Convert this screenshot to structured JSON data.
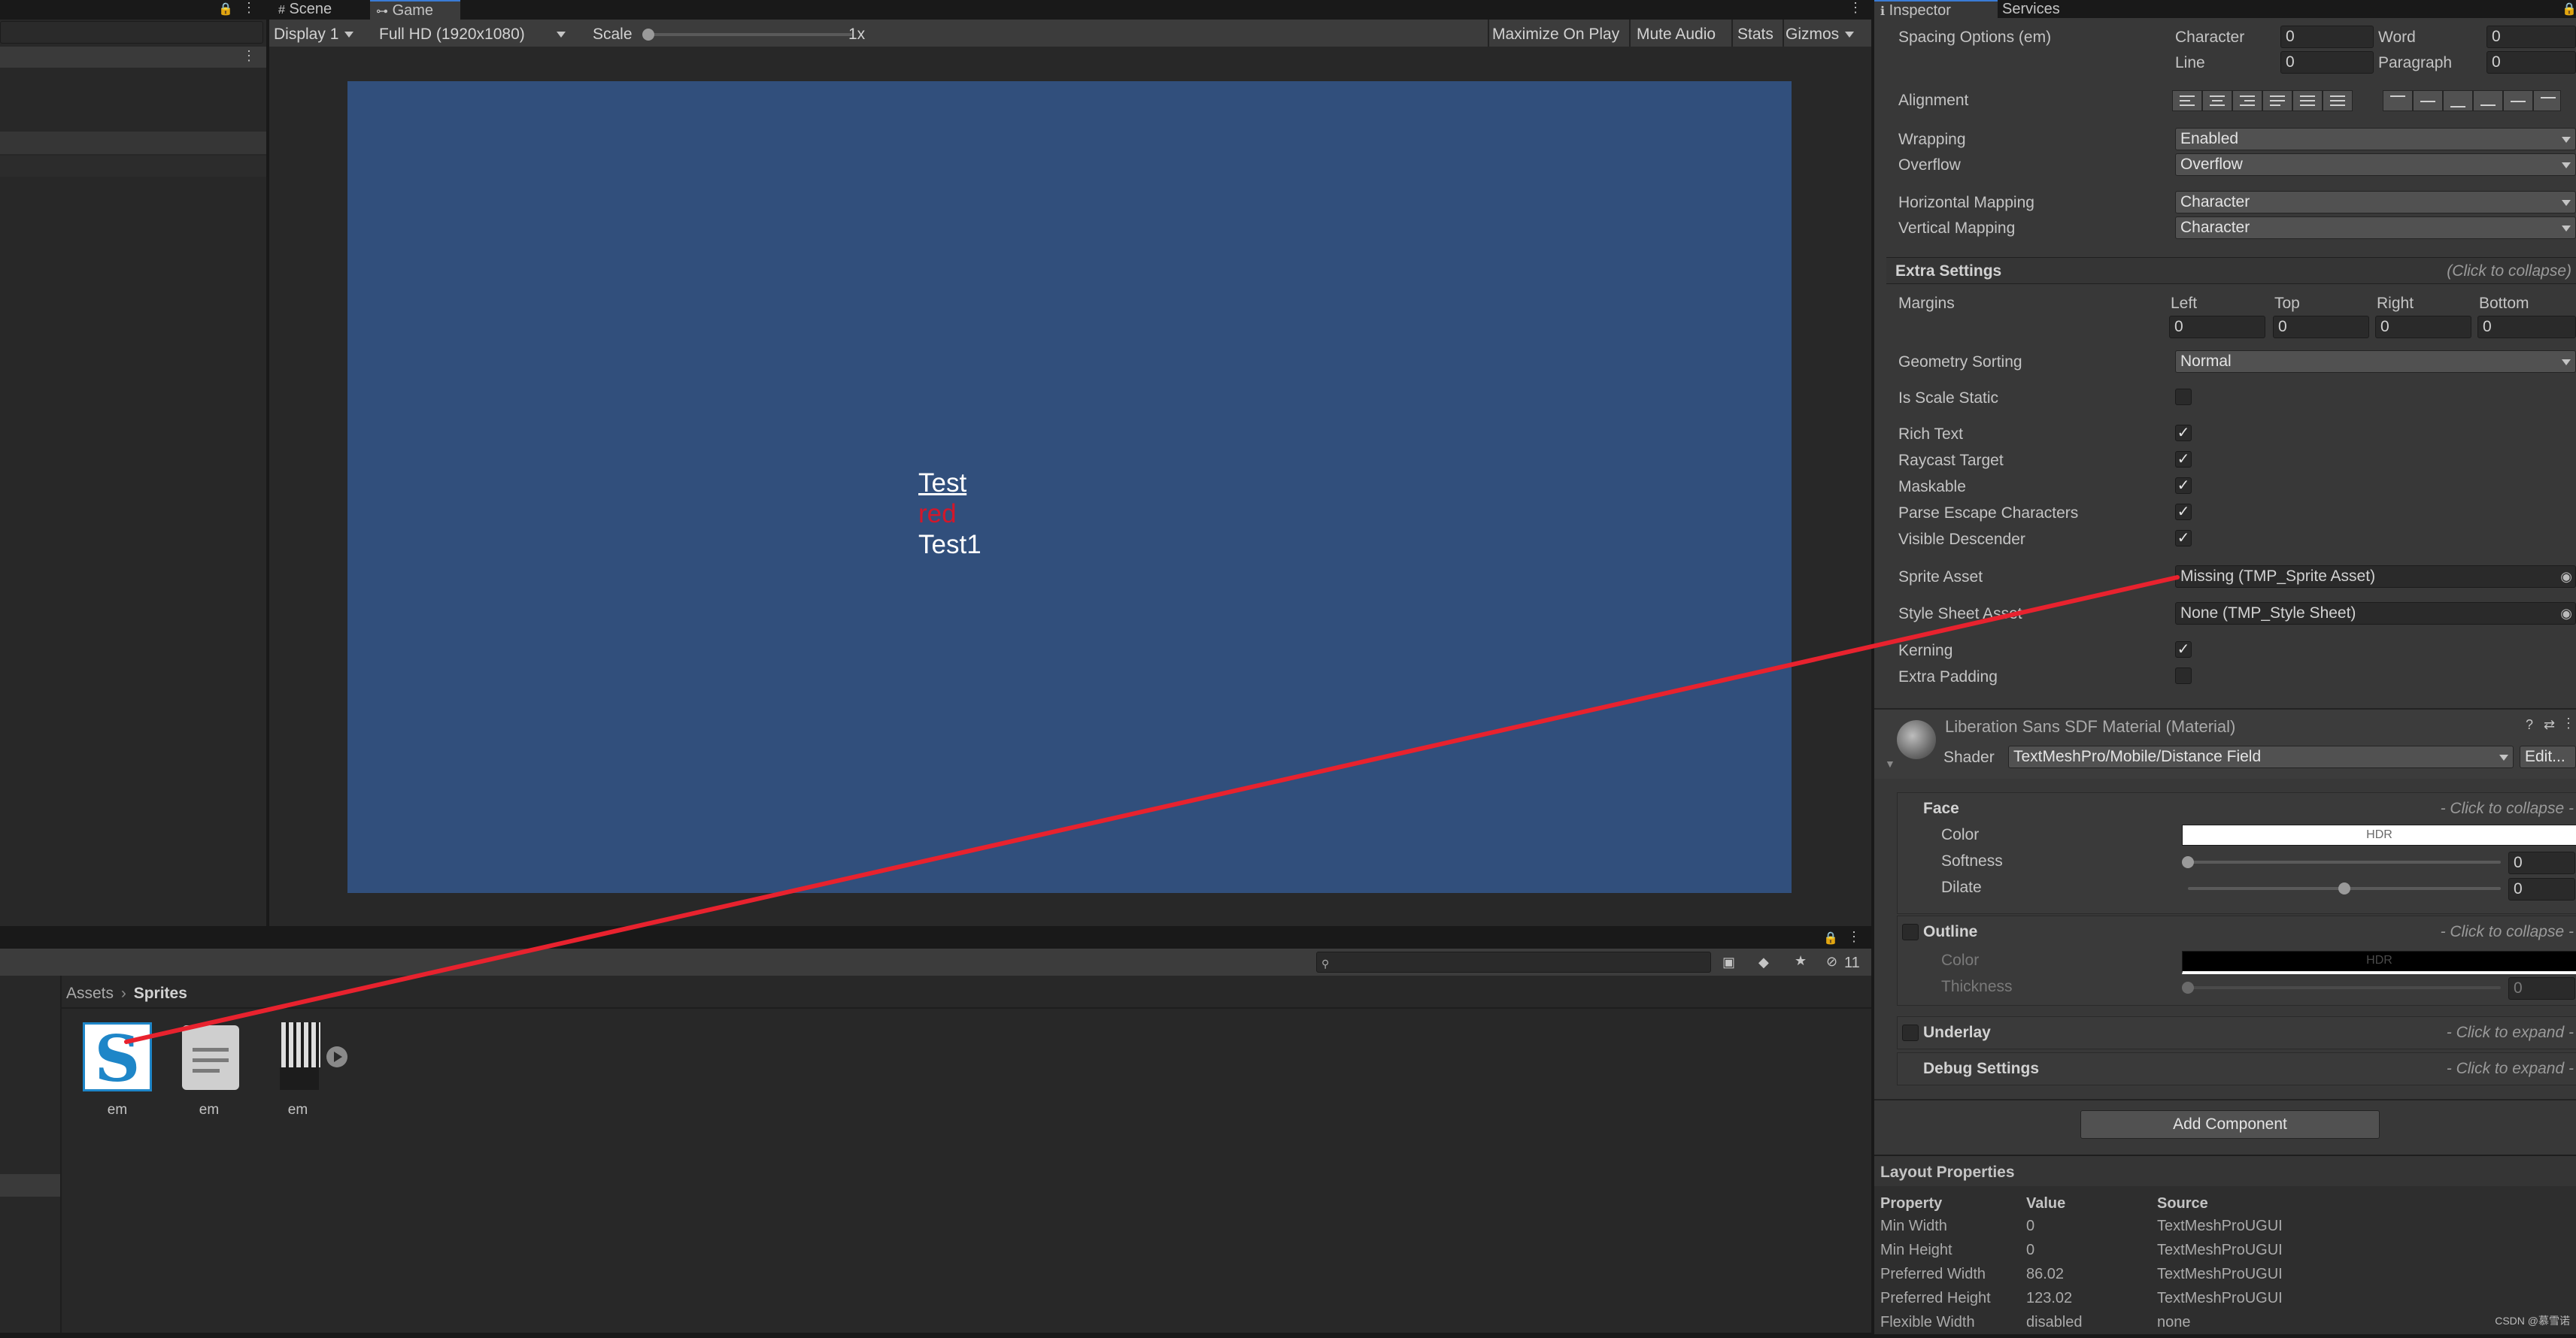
{
  "hierarchy": {
    "lock": "🔒",
    "menu": "⋮"
  },
  "game_view": {
    "tabs": [
      {
        "label": "Scene",
        "icon": "scene-grid-icon"
      },
      {
        "label": "Game",
        "icon": "gamepad-icon"
      }
    ],
    "menu": "⋮",
    "toolbar": {
      "display": "Display 1",
      "resolution": "Full HD (1920x1080)",
      "scale_label": "Scale",
      "scale_value": "1x",
      "maximize": "Maximize On Play",
      "mute": "Mute Audio",
      "stats": "Stats",
      "gizmos": "Gizmos"
    },
    "canvas_text": {
      "line1": "Test",
      "line2": "red",
      "line3": "Test1"
    },
    "colors": {
      "background": "#314f7c",
      "red_text": "#d3172a",
      "annotation_line": "#e8222e"
    }
  },
  "project": {
    "lock": "🔒",
    "menu": "⋮",
    "search_placeholder": "",
    "hidden_count": "11",
    "breadcrumb": [
      "Assets",
      "Sprites"
    ],
    "assets": [
      {
        "label": "em",
        "icon": "sprite-asset-s-icon"
      },
      {
        "label": "em",
        "icon": "text-document-icon"
      },
      {
        "label": "em",
        "icon": "sprite-sheet-texture-icon"
      }
    ]
  },
  "inspector": {
    "tabs": {
      "inspector": "Inspector",
      "services": "Services"
    },
    "spacing": {
      "label": "Spacing Options (em)",
      "character_label": "Character",
      "character": "0",
      "word_label": "Word",
      "word": "0",
      "line_label": "Line",
      "line": "0",
      "paragraph_label": "Paragraph",
      "paragraph": "0"
    },
    "alignment_label": "Alignment",
    "wrapping": {
      "label": "Wrapping",
      "value": "Enabled"
    },
    "overflow": {
      "label": "Overflow",
      "value": "Overflow"
    },
    "horizontal_mapping": {
      "label": "Horizontal Mapping",
      "value": "Character"
    },
    "vertical_mapping": {
      "label": "Vertical Mapping",
      "value": "Character"
    },
    "extra_settings": {
      "title": "Extra Settings",
      "hint": "(Click to collapse)"
    },
    "margins": {
      "label": "Margins",
      "left_label": "Left",
      "left": "0",
      "top_label": "Top",
      "top": "0",
      "right_label": "Right",
      "right": "0",
      "bottom_label": "Bottom",
      "bottom": "0"
    },
    "geometry_sorting": {
      "label": "Geometry Sorting",
      "value": "Normal"
    },
    "is_scale_static": {
      "label": "Is Scale Static",
      "checked": false
    },
    "rich_text": {
      "label": "Rich Text",
      "checked": true
    },
    "raycast_target": {
      "label": "Raycast Target",
      "checked": true
    },
    "maskable": {
      "label": "Maskable",
      "checked": true
    },
    "parse_escape": {
      "label": "Parse Escape Characters",
      "checked": true
    },
    "visible_descender": {
      "label": "Visible Descender",
      "checked": true
    },
    "sprite_asset": {
      "label": "Sprite Asset",
      "value": "Missing (TMP_Sprite Asset)"
    },
    "style_sheet": {
      "label": "Style Sheet Asset",
      "value": "None (TMP_Style Sheet)"
    },
    "kerning": {
      "label": "Kerning",
      "checked": true
    },
    "extra_padding": {
      "label": "Extra Padding",
      "checked": false
    },
    "material": {
      "name": "Liberation Sans SDF Material (Material)",
      "shader_label": "Shader",
      "shader_value": "TextMeshPro/Mobile/Distance Field",
      "edit": "Edit..."
    },
    "face": {
      "title": "Face",
      "hint": "- Click to collapse -",
      "color_label": "Color",
      "color_value": "HDR",
      "softness_label": "Softness",
      "softness": "0",
      "softness_level": 0,
      "dilate_label": "Dilate",
      "dilate": "0",
      "dilate_level": 0.5
    },
    "outline": {
      "title": "Outline",
      "hint": "- Click to collapse -",
      "color_label": "Color",
      "color_value": "HDR",
      "thickness_label": "Thickness",
      "thickness": "0",
      "thickness_level": 0
    },
    "underlay": {
      "title": "Underlay",
      "hint": "- Click to expand -"
    },
    "debug": {
      "title": "Debug Settings",
      "hint": "- Click to expand -"
    },
    "add_component": "Add Component",
    "layout_properties": {
      "title": "Layout Properties",
      "headers": [
        "Property",
        "Value",
        "Source"
      ],
      "rows": [
        [
          "Min Width",
          "0",
          "TextMeshProUGUI"
        ],
        [
          "Min Height",
          "0",
          "TextMeshProUGUI"
        ],
        [
          "Preferred Width",
          "86.02",
          "TextMeshProUGUI"
        ],
        [
          "Preferred Height",
          "123.02",
          "TextMeshProUGUI"
        ],
        [
          "Flexible Width",
          "disabled",
          "none"
        ]
      ]
    }
  },
  "watermark": "CSDN @慕雪诺"
}
